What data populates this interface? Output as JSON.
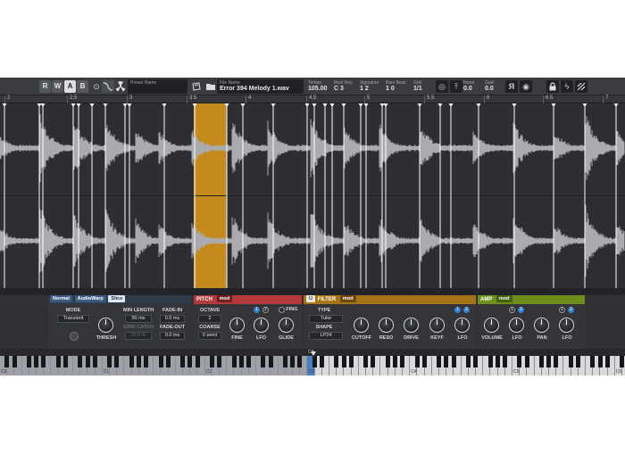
{
  "toolbar": {
    "buttons": [
      "R",
      "W",
      "A",
      "B"
    ],
    "preset_label": "Preset Name",
    "preset_value": "",
    "file_label": "File Name",
    "file_value": "Error 394 Melody 1.wav",
    "fields": [
      {
        "label": "Tempo",
        "value": "105.00"
      },
      {
        "label": "Root Key",
        "value": "C 3"
      },
      {
        "label": "Signature",
        "value": "1   2"
      },
      {
        "label": "Bars Beat",
        "value": "1   0"
      },
      {
        "label": "Grid",
        "value": "1/1"
      }
    ],
    "norm_label": "Norm",
    "norm_value": "0.0",
    "gain_label": "Gain",
    "gain_value": "0.0"
  },
  "ruler": {
    "labels": [
      "2",
      "2.5",
      "3",
      "3.5",
      "4",
      "4.5",
      "5",
      "5.5",
      "6",
      "6.5",
      "7"
    ]
  },
  "waveform": {
    "selected_region_color": "#c58a1d",
    "slice_color": "#ffffff"
  },
  "sample": {
    "modes": [
      "Normal",
      "AudioWarp",
      "Slice"
    ],
    "active_mode": "Slice",
    "mode_label": "MODE",
    "mode_value": "Transient",
    "thresh_label": "THRESH",
    "min_length_label": "MIN LENGTH",
    "min_length_value": "50 ms",
    "grid_catch_label": "GRID CATCH",
    "grid_catch_value": "10.0 %",
    "fade_in_label": "FADE-IN",
    "fade_in_value": "0.0 ms",
    "fade_out_label": "FADE-OUT",
    "fade_out_value": "0.0 ms"
  },
  "pitch": {
    "title": "PITCH",
    "mod": "mod",
    "color": "#b23a3a",
    "octave_label": "OCTAVE",
    "octave_value": "2",
    "coarse_label": "COARSE",
    "coarse_value": "0 semi",
    "fine_label": "FINE",
    "lfo_label": "LFO",
    "fing_label": "FING",
    "glide_label": "GLIDE",
    "dots": [
      "1",
      "2"
    ]
  },
  "filter": {
    "title": "FILTER",
    "mod": "mod",
    "power": "U",
    "color": "#a57416",
    "type_label": "TYPE",
    "type_value": "Tube",
    "shape_label": "SHAPE",
    "shape_value": "LP24",
    "knobs": [
      "CUTOFF",
      "RESO",
      "DRIVE",
      "KEYF",
      "LFO"
    ],
    "dots": [
      "1",
      "2"
    ]
  },
  "amp": {
    "title": "AMP",
    "mod": "mod",
    "color": "#6e8e1c",
    "knobs": [
      "VOLUME",
      "LFO",
      "PAN",
      "LFO"
    ],
    "dots_a": [
      "1",
      "2"
    ],
    "dots_b": [
      "1",
      "2"
    ]
  },
  "keyboard": {
    "current_note": "C3",
    "octave_labels": [
      "C0",
      "C1",
      "C2",
      "C3",
      "C4",
      "C5",
      "C6"
    ]
  }
}
